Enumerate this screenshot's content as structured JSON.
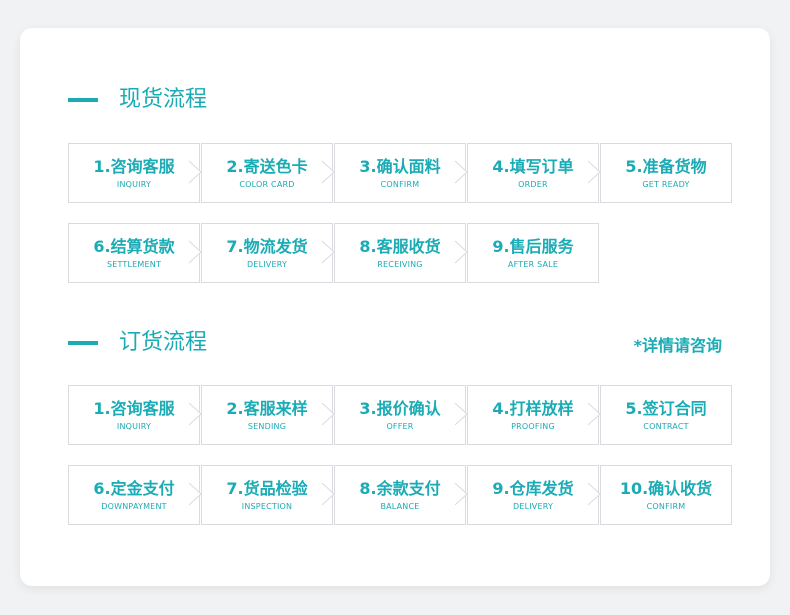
{
  "spot": {
    "title": "现货流程",
    "rows": [
      [
        {
          "title": "1.咨询客服",
          "sub": "INQUIRY"
        },
        {
          "title": "2.寄送色卡",
          "sub": "COLOR CARD"
        },
        {
          "title": "3.确认面料",
          "sub": "CONFIRM"
        },
        {
          "title": "4.填写订单",
          "sub": "ORDER"
        },
        {
          "title": "5.准备货物",
          "sub": "GET READY"
        }
      ],
      [
        {
          "title": "6.结算货款",
          "sub": "SETTLEMENT"
        },
        {
          "title": "7.物流发货",
          "sub": "DELIVERY"
        },
        {
          "title": "8.客服收货",
          "sub": "RECEIVING"
        },
        {
          "title": "9.售后服务",
          "sub": "AFTER SALE"
        }
      ]
    ]
  },
  "order": {
    "title": "订货流程",
    "note": "*详情请咨询",
    "rows": [
      [
        {
          "title": "1.咨询客服",
          "sub": "INQUIRY"
        },
        {
          "title": "2.客服来样",
          "sub": "SENDING"
        },
        {
          "title": "3.报价确认",
          "sub": "OFFER"
        },
        {
          "title": "4.打样放样",
          "sub": "PROOFING"
        },
        {
          "title": "5.签订合同",
          "sub": "CONTRACT"
        }
      ],
      [
        {
          "title": "6.定金支付",
          "sub": "DOWNPAYMENT"
        },
        {
          "title": "7.货品检验",
          "sub": "INSPECTION"
        },
        {
          "title": "8.余款支付",
          "sub": "BALANCE"
        },
        {
          "title": "9.仓库发货",
          "sub": "DELIVERY"
        },
        {
          "title": "10.确认收货",
          "sub": "CONFIRM"
        }
      ]
    ]
  },
  "colors": {
    "accent": "#1aabb5",
    "border": "#d9dbde",
    "background": "#f1f2f4"
  },
  "icons": {
    "step_separator": "chevron-right-icon"
  }
}
